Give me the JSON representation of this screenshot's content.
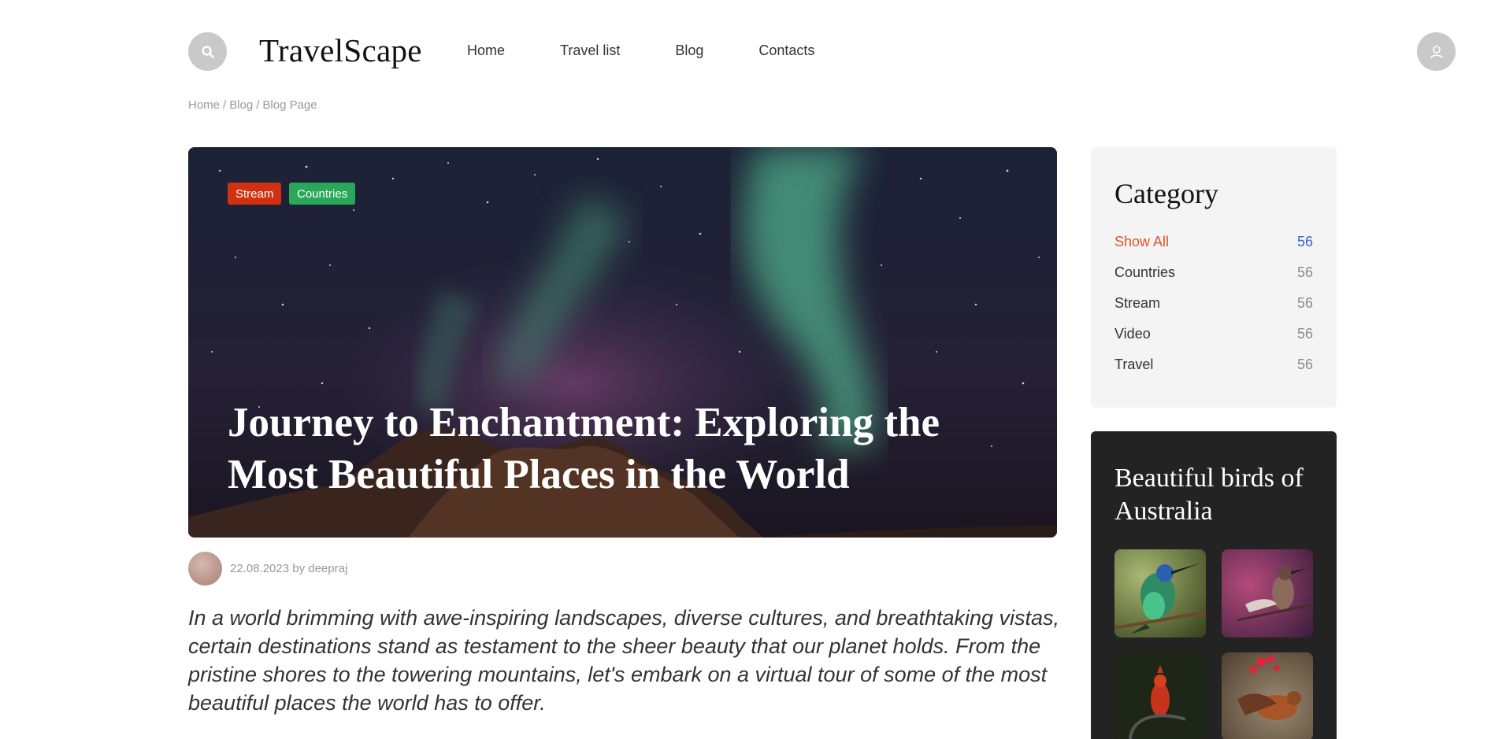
{
  "header": {
    "logo": "TravelScape",
    "nav": [
      "Home",
      "Travel list",
      "Blog",
      "Contacts"
    ],
    "search_icon": "search-icon",
    "user_icon": "user-icon"
  },
  "breadcrumb": [
    "Home",
    "Blog",
    "Blog Page"
  ],
  "hero": {
    "tags": [
      "Stream",
      "Countries"
    ],
    "title": "Journey to Enchantment: Exploring the Most Beautiful Places in the World",
    "tag_colors": {
      "Stream": "#d1310f",
      "Countries": "#2aa85a"
    }
  },
  "post_meta": "22.08.2023 by deepraj",
  "intro": "In a world brimming with awe-inspiring landscapes, diverse cultures, and breathtaking vistas, certain destinations stand as testament to the sheer beauty that our planet holds. From the pristine shores to the towering mountains, let's embark on a virtual tour of some of the most beautiful places the world has to offer.",
  "sidebar": {
    "category_title": "Category",
    "categories": [
      {
        "name": "Show All",
        "count": "56"
      },
      {
        "name": "Countries",
        "count": "56"
      },
      {
        "name": "Stream",
        "count": "56"
      },
      {
        "name": "Video",
        "count": "56"
      },
      {
        "name": "Travel",
        "count": "56"
      }
    ],
    "birds_title": "Beautiful birds of Australia"
  },
  "colors": {
    "accent": "#e0562a",
    "count_active": "#3a5fd0"
  }
}
